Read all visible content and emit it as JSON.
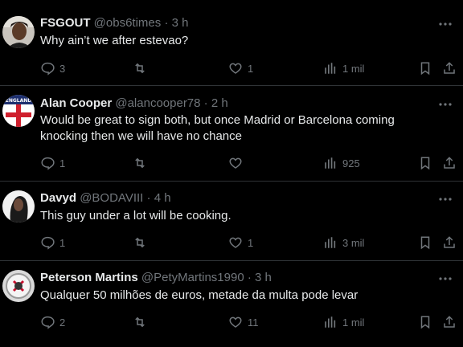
{
  "colors": {
    "background": "#000000",
    "text_primary": "#e7e9ea",
    "text_secondary": "#71767b",
    "divider": "#2f3336"
  },
  "icons": {
    "more": "more-horizontal-icon",
    "reply": "reply-icon",
    "retweet": "retweet-icon",
    "like": "heart-icon",
    "views": "views-bar-chart-icon",
    "bookmark": "bookmark-icon",
    "share": "share-icon"
  },
  "tweets": [
    {
      "name": "FSGOUT",
      "handle": "@obs6times",
      "dot": "·",
      "time": "3 h",
      "text": "Why ain’t we after estevao?",
      "replies": "3",
      "retweets": "",
      "likes": "1",
      "views": "1 mil"
    },
    {
      "name": "Alan Cooper",
      "handle": "@alancooper78",
      "dot": "·",
      "time": "2 h",
      "text": "Would be great to sign both,  but once Madrid or Barcelona coming knocking then we will have no chance",
      "replies": "1",
      "retweets": "",
      "likes": "",
      "views": "925"
    },
    {
      "name": "Davyd",
      "handle": "@BODAVIII",
      "dot": "·",
      "time": "4 h",
      "text": "This guy under a lot will be cooking.",
      "replies": "1",
      "retweets": "",
      "likes": "1",
      "views": "3 mil"
    },
    {
      "name": "Peterson Martins",
      "handle": "@PetyMartins1990",
      "dot": "·",
      "time": "3 h",
      "text": "Qualquer 50 milhões de euros,  metade da multa pode levar",
      "replies": "2",
      "retweets": "",
      "likes": "11",
      "views": "1 mil"
    }
  ]
}
